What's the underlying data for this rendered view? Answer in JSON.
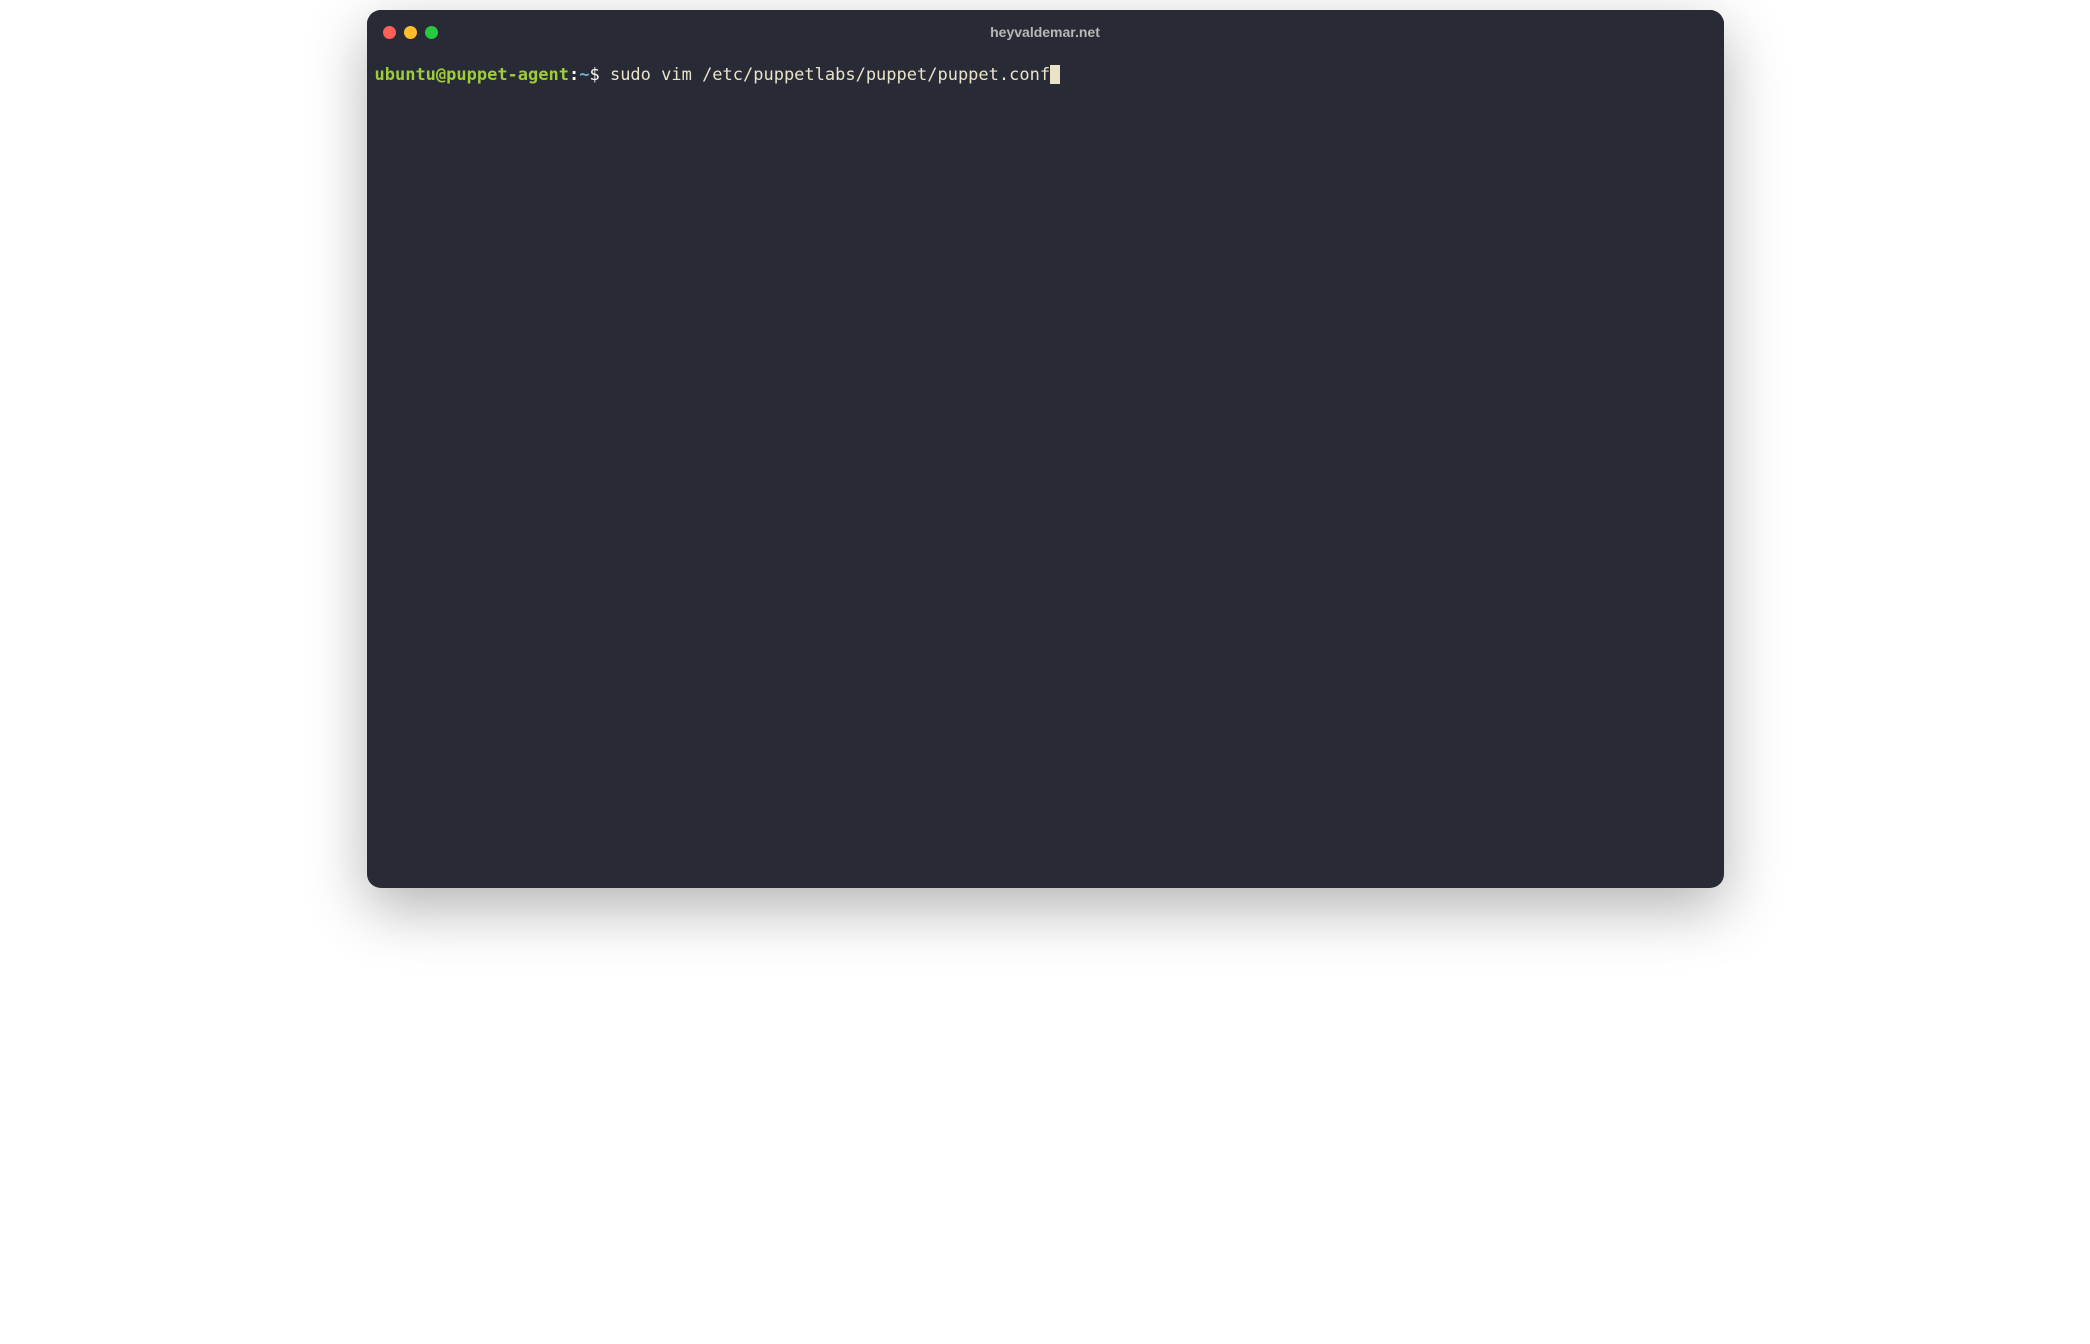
{
  "window": {
    "title": "heyvaldemar.net"
  },
  "terminal": {
    "prompt": {
      "user_host": "ubuntu@puppet-agent",
      "separator": ":",
      "path": "~",
      "symbol": "$ "
    },
    "command": "sudo vim /etc/puppetlabs/puppet/puppet.conf"
  },
  "colors": {
    "background": "#282a36",
    "foreground": "#f8f8f2",
    "prompt_green": "#9ecb3a",
    "prompt_blue": "#6fb3d2",
    "command": "#e9e4c8",
    "cursor": "#e9e4c8",
    "traffic_red": "#ff5f56",
    "traffic_yellow": "#ffbd2e",
    "traffic_green": "#27c93f"
  }
}
